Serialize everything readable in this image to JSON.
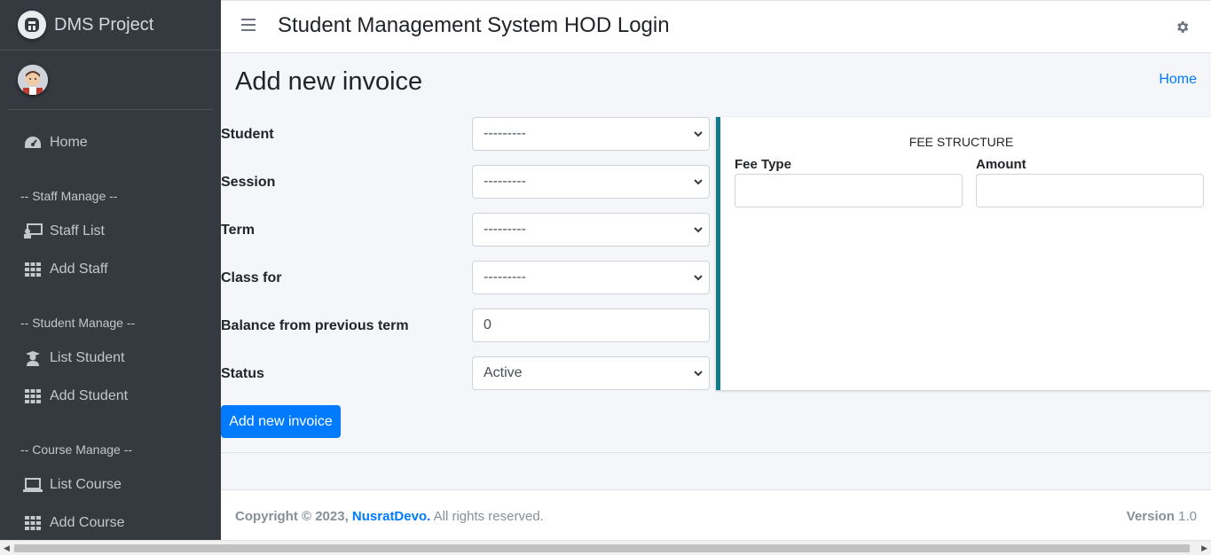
{
  "sidebar": {
    "brand": "DMS Project",
    "items": [
      {
        "label": "Home",
        "icon": "tachometer-icon"
      },
      {
        "header": "-- Staff Manage --"
      },
      {
        "label": "Staff List",
        "icon": "chalkboard-teacher-icon"
      },
      {
        "label": "Add Staff",
        "icon": "grid-icon"
      },
      {
        "header": "-- Student Manage --"
      },
      {
        "label": "List Student",
        "icon": "graduate-icon"
      },
      {
        "label": "Add Student",
        "icon": "grid-icon"
      },
      {
        "header": "-- Course Manage --"
      },
      {
        "label": "List Course",
        "icon": "laptop-icon"
      },
      {
        "label": "Add Course",
        "icon": "grid-icon"
      }
    ]
  },
  "navbar": {
    "title": "Student Management System HOD Login"
  },
  "page": {
    "title": "Add new invoice",
    "breadcrumb": "Home"
  },
  "form": {
    "student_label": "Student",
    "student_value": "---------",
    "session_label": "Session",
    "session_value": "---------",
    "term_label": "Term",
    "term_value": "---------",
    "class_label": "Class for",
    "class_value": "---------",
    "balance_label": "Balance from previous term",
    "balance_value": "0",
    "status_label": "Status",
    "status_value": "Active",
    "submit_label": "Add new invoice"
  },
  "fee_structure": {
    "title": "FEE STRUCTURE",
    "fee_type_label": "Fee Type",
    "amount_label": "Amount"
  },
  "footer": {
    "copyright": "Copyright © 2023,",
    "author": "NusratDevo.",
    "rights": "All rights reserved.",
    "version_label": "Version",
    "version_value": "1.0"
  },
  "colors": {
    "sidebar_bg": "#343a40",
    "primary": "#007bff",
    "card_accent": "#117a8b"
  }
}
